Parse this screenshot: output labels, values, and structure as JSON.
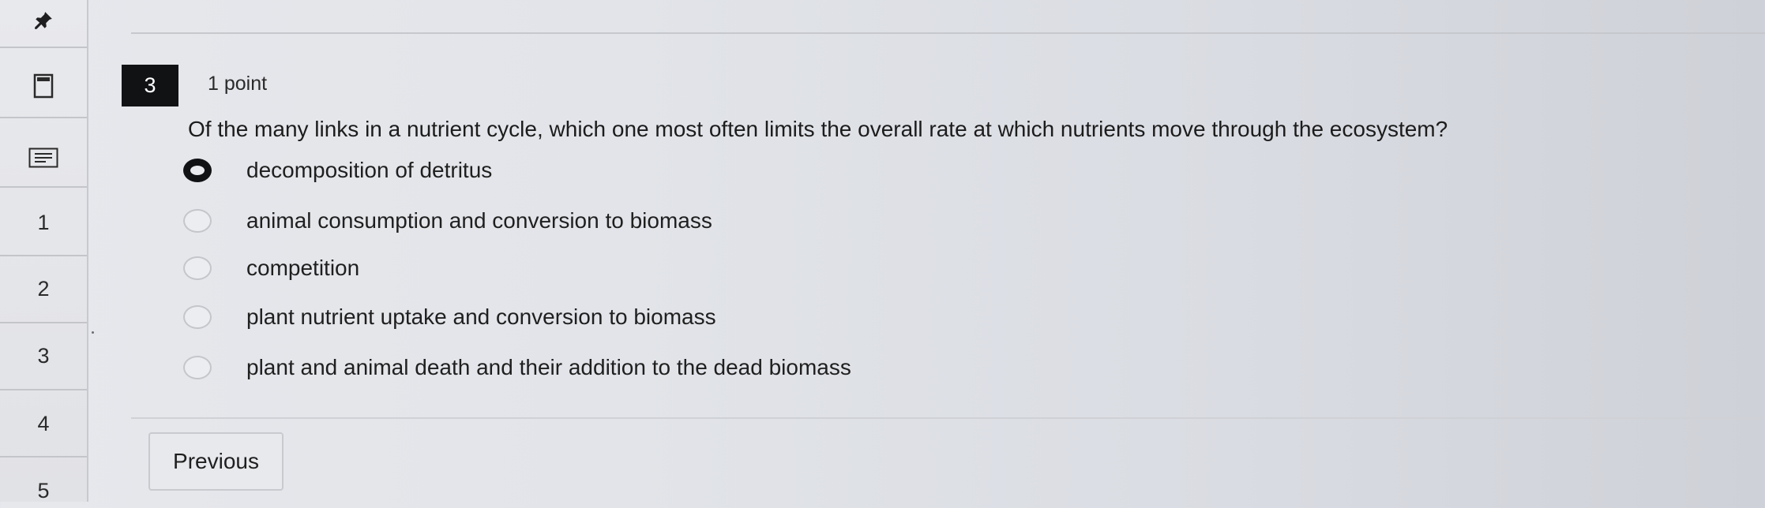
{
  "nav": {
    "icons": [
      "pin-icon",
      "bookmark-icon",
      "notes-icon"
    ],
    "questions": [
      "1",
      "2",
      "3",
      "4",
      "5"
    ]
  },
  "question": {
    "number": "3",
    "points": "1 point",
    "text": "Of the many links in a nutrient cycle, which one most often limits the overall rate at which nutrients move through the ecosystem?",
    "options": [
      {
        "label": "decomposition of detritus",
        "selected": true
      },
      {
        "label": "animal consumption and conversion to biomass",
        "selected": false
      },
      {
        "label": "competition",
        "selected": false
      },
      {
        "label": "plant nutrient uptake and conversion to biomass",
        "selected": false
      },
      {
        "label": "plant and animal death and their addition to the dead biomass",
        "selected": false
      }
    ]
  },
  "buttons": {
    "previous": "Previous"
  },
  "colors": {
    "accent": "#111214",
    "background": "#e2e4e9",
    "border": "#c6c8cd"
  }
}
